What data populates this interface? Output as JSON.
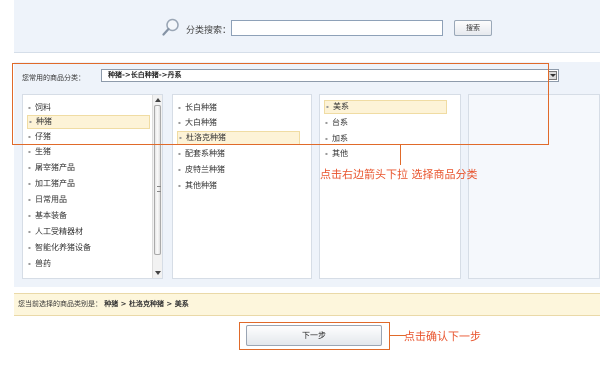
{
  "search": {
    "label": "分类搜索：",
    "input_value": "",
    "button_label": "搜索"
  },
  "recent": {
    "label": "您常用的商品分类：",
    "selected": "种猪->长白种猪->丹系"
  },
  "level1": {
    "items": [
      "饲料",
      "种猪",
      "仔猪",
      "生猪",
      "屠宰猪产品",
      "加工猪产品",
      "日常用品",
      "基本装备",
      "人工受精器材",
      "智能化养猪设备",
      "兽药"
    ],
    "selected_index": 1
  },
  "level2": {
    "items": [
      "长白种猪",
      "大白种猪",
      "杜洛克种猪",
      "配套系种猪",
      "皮特兰种猪",
      "其他种猪"
    ],
    "selected_index": 2
  },
  "level3": {
    "items": [
      "美系",
      "台系",
      "加系",
      "其他"
    ],
    "selected_index": 0
  },
  "annotations": {
    "dropdown_hint": "点击右边箭头下拉 选择商品分类",
    "next_hint": "点击确认下一步"
  },
  "path": {
    "label": "您当前选择的商品类别是：",
    "value": "种猪 > 杜洛克种猪 > 美系"
  },
  "next_button_label": "下一步",
  "colors": {
    "accent": "#e06a2a",
    "annotation_text": "#e8532c",
    "panel_bg": "#eef3fa",
    "selection_bg": "#fdf3d7"
  }
}
